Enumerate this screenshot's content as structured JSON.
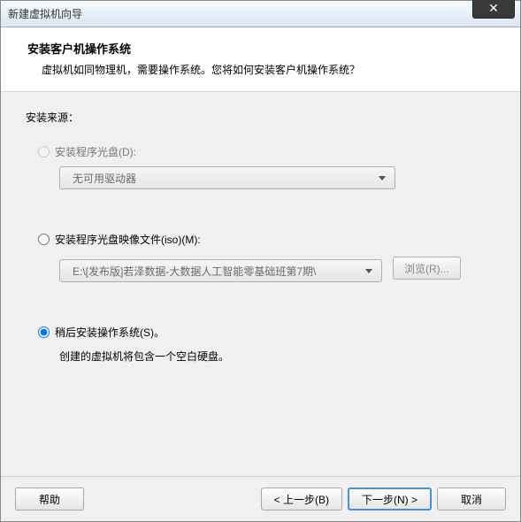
{
  "window": {
    "title": "新建虚拟机向导",
    "close_glyph": "✕"
  },
  "header": {
    "title": "安装客户机操作系统",
    "subtitle": "虚拟机如同物理机，需要操作系统。您将如何安装客户机操作系统？"
  },
  "source": {
    "label": "安装来源：",
    "option_disc": {
      "label": "安装程序光盘(D):",
      "dropdown_value": "无可用驱动器"
    },
    "option_iso": {
      "label": "安装程序光盘映像文件(iso)(M):",
      "path": "E:\\[发布版]若泽数据-大数据人工智能零基础班第7期\\",
      "browse_label": "浏览(R)..."
    },
    "option_later": {
      "label": "稍后安装操作系统(S)。",
      "hint": "创建的虚拟机将包含一个空白硬盘。"
    }
  },
  "footer": {
    "help": "帮助",
    "back": "< 上一步(B)",
    "next": "下一步(N) >",
    "cancel": "取消"
  }
}
